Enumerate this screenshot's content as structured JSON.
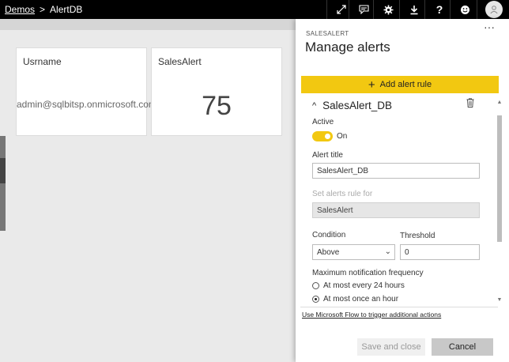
{
  "breadcrumb": {
    "root": "Demos",
    "separator": ">",
    "current": "AlertDB"
  },
  "topbar": {
    "icons": [
      "fullscreen-icon",
      "comment-icon",
      "gear-icon",
      "download-icon",
      "help-icon",
      "smiley-icon",
      "user-avatar-icon"
    ],
    "help_glyph": "?"
  },
  "tiles": [
    {
      "title": "Usrname",
      "value": "admin@sqlbitsp.onmicrosoft.com"
    },
    {
      "title": "SalesAlert",
      "value": "75"
    }
  ],
  "panel": {
    "kicker": "SALESALERT",
    "title": "Manage alerts",
    "more": "···",
    "add_rule_label": "Add alert rule",
    "add_rule_plus": "+",
    "rule": {
      "chevron": "^",
      "name": "SalesAlert_DB",
      "active_label": "Active",
      "active_state": "On",
      "alert_title_label": "Alert title",
      "alert_title_value": "SalesAlert_DB",
      "set_rule_label": "Set alerts rule for",
      "set_rule_value": "SalesAlert",
      "condition_label": "Condition",
      "condition_value": "Above",
      "threshold_label": "Threshold",
      "threshold_value": "0",
      "frequency_label": "Maximum notification frequency",
      "frequency_options": [
        {
          "label": "At most every 24 hours",
          "selected": false
        },
        {
          "label": "At most once an hour",
          "selected": true
        }
      ]
    },
    "flow_link": "Use Microsoft Flow to trigger additional actions",
    "save_label": "Save and close",
    "cancel_label": "Cancel"
  },
  "colors": {
    "accent": "#f2c811",
    "topbar": "#000000"
  }
}
